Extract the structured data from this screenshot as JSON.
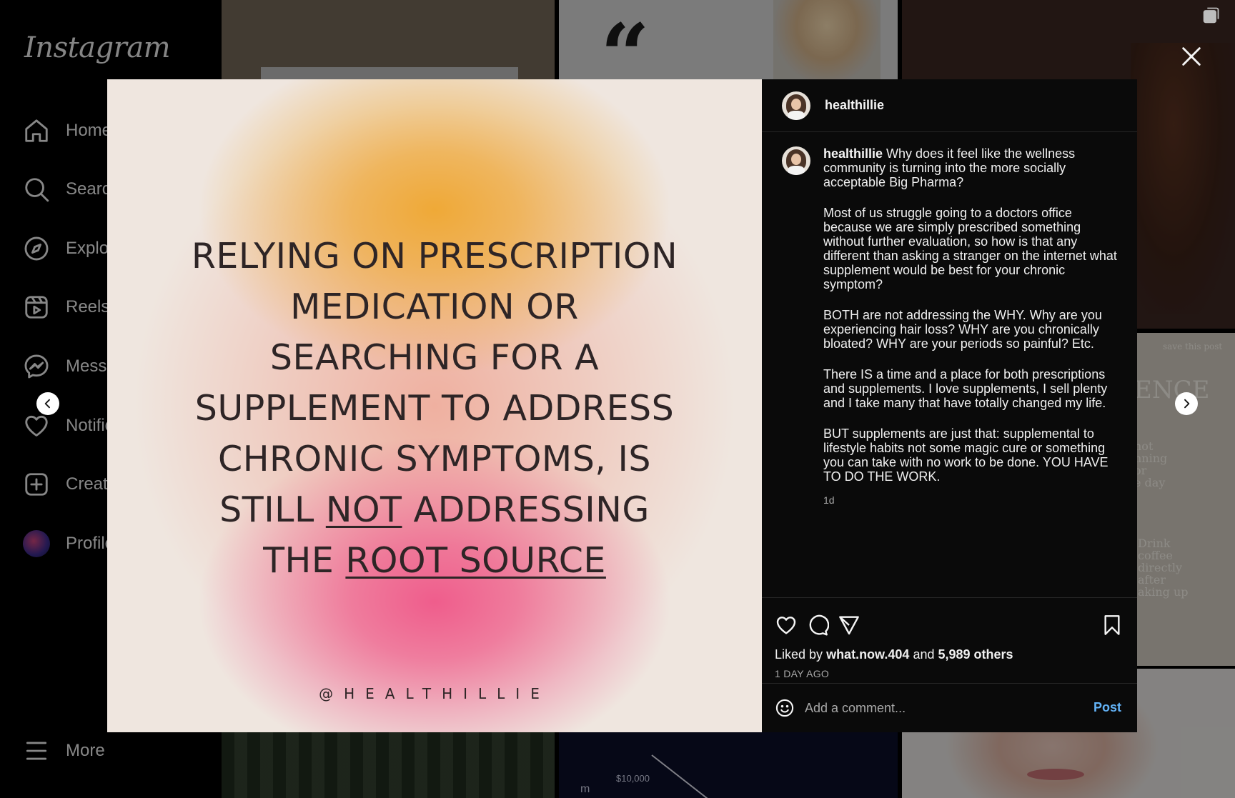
{
  "sidebar": {
    "logo": "Instagram",
    "items": [
      {
        "id": "home",
        "label": "Home",
        "icon": "home-icon"
      },
      {
        "id": "search",
        "label": "Search",
        "icon": "search-icon"
      },
      {
        "id": "explore",
        "label": "Explore",
        "icon": "compass-icon"
      },
      {
        "id": "reels",
        "label": "Reels",
        "icon": "reels-icon"
      },
      {
        "id": "messages",
        "label": "Messages",
        "icon": "messenger-icon"
      },
      {
        "id": "notifications",
        "label": "Notifications",
        "icon": "heart-icon"
      },
      {
        "id": "create",
        "label": "Create",
        "icon": "plus-square-icon"
      },
      {
        "id": "profile",
        "label": "Profile",
        "icon": "avatar"
      }
    ],
    "more_label": "More"
  },
  "background": {
    "chart_tick": "$10,000",
    "chart_side": "m",
    "save_post_text": "save this post",
    "serif_word": "ENCE",
    "serif_snippet1": [
      "not",
      "nning",
      "or",
      "e day"
    ],
    "serif_snippet2": [
      "Drink",
      "coffee",
      "directly",
      "after",
      "aking up"
    ]
  },
  "post": {
    "image_text": {
      "lines": [
        [
          {
            "t": "RELYING ON PRESCRIPTION"
          }
        ],
        [
          {
            "t": "MEDICATION OR"
          }
        ],
        [
          {
            "t": "SEARCHING FOR A"
          }
        ],
        [
          {
            "t": "SUPPLEMENT TO ADDRESS"
          }
        ],
        [
          {
            "t": "CHRONIC SYMPTOMS, IS"
          }
        ],
        [
          {
            "t": "STILL "
          },
          {
            "t": "NOT",
            "u": true
          },
          {
            "t": " ADDRESSING"
          }
        ],
        [
          {
            "t": "THE "
          },
          {
            "t": "ROOT SOURCE",
            "u": true
          }
        ]
      ],
      "handle": "@HEALTHILLIE"
    },
    "colors": {
      "accent_orange": "#efa937",
      "accent_pink": "#ef5d8c",
      "post_blue": "#63b3f7"
    },
    "username": "healthillie",
    "caption": {
      "first": "Why does it feel like the wellness community is turning into the more socially acceptable Big Pharma?",
      "paragraphs": [
        "Most of us struggle going to a doctors office because we are simply prescribed something without further evaluation, so how is that any different than asking a stranger on the internet what supplement would be best for your chronic symptom?",
        "BOTH are not addressing the WHY. Why are you experiencing hair loss? WHY are you chronically bloated? WHY are your periods so painful? Etc.",
        "There IS a time and a place for both prescriptions and supplements. I love supplements, I sell plenty and I take many that have totally changed my life.",
        "BUT supplements are just that: supplemental to lifestyle habits not some magic cure or something you can take with no work to be done. YOU HAVE TO DO THE WORK."
      ],
      "time": "1d"
    },
    "likes": {
      "prefix": "Liked by",
      "user": "what.now.404",
      "and": "and",
      "others": "5,989 others"
    },
    "time_ago": "1 DAY AGO",
    "comment": {
      "placeholder": "Add a comment...",
      "value": "",
      "post_label": "Post"
    }
  }
}
